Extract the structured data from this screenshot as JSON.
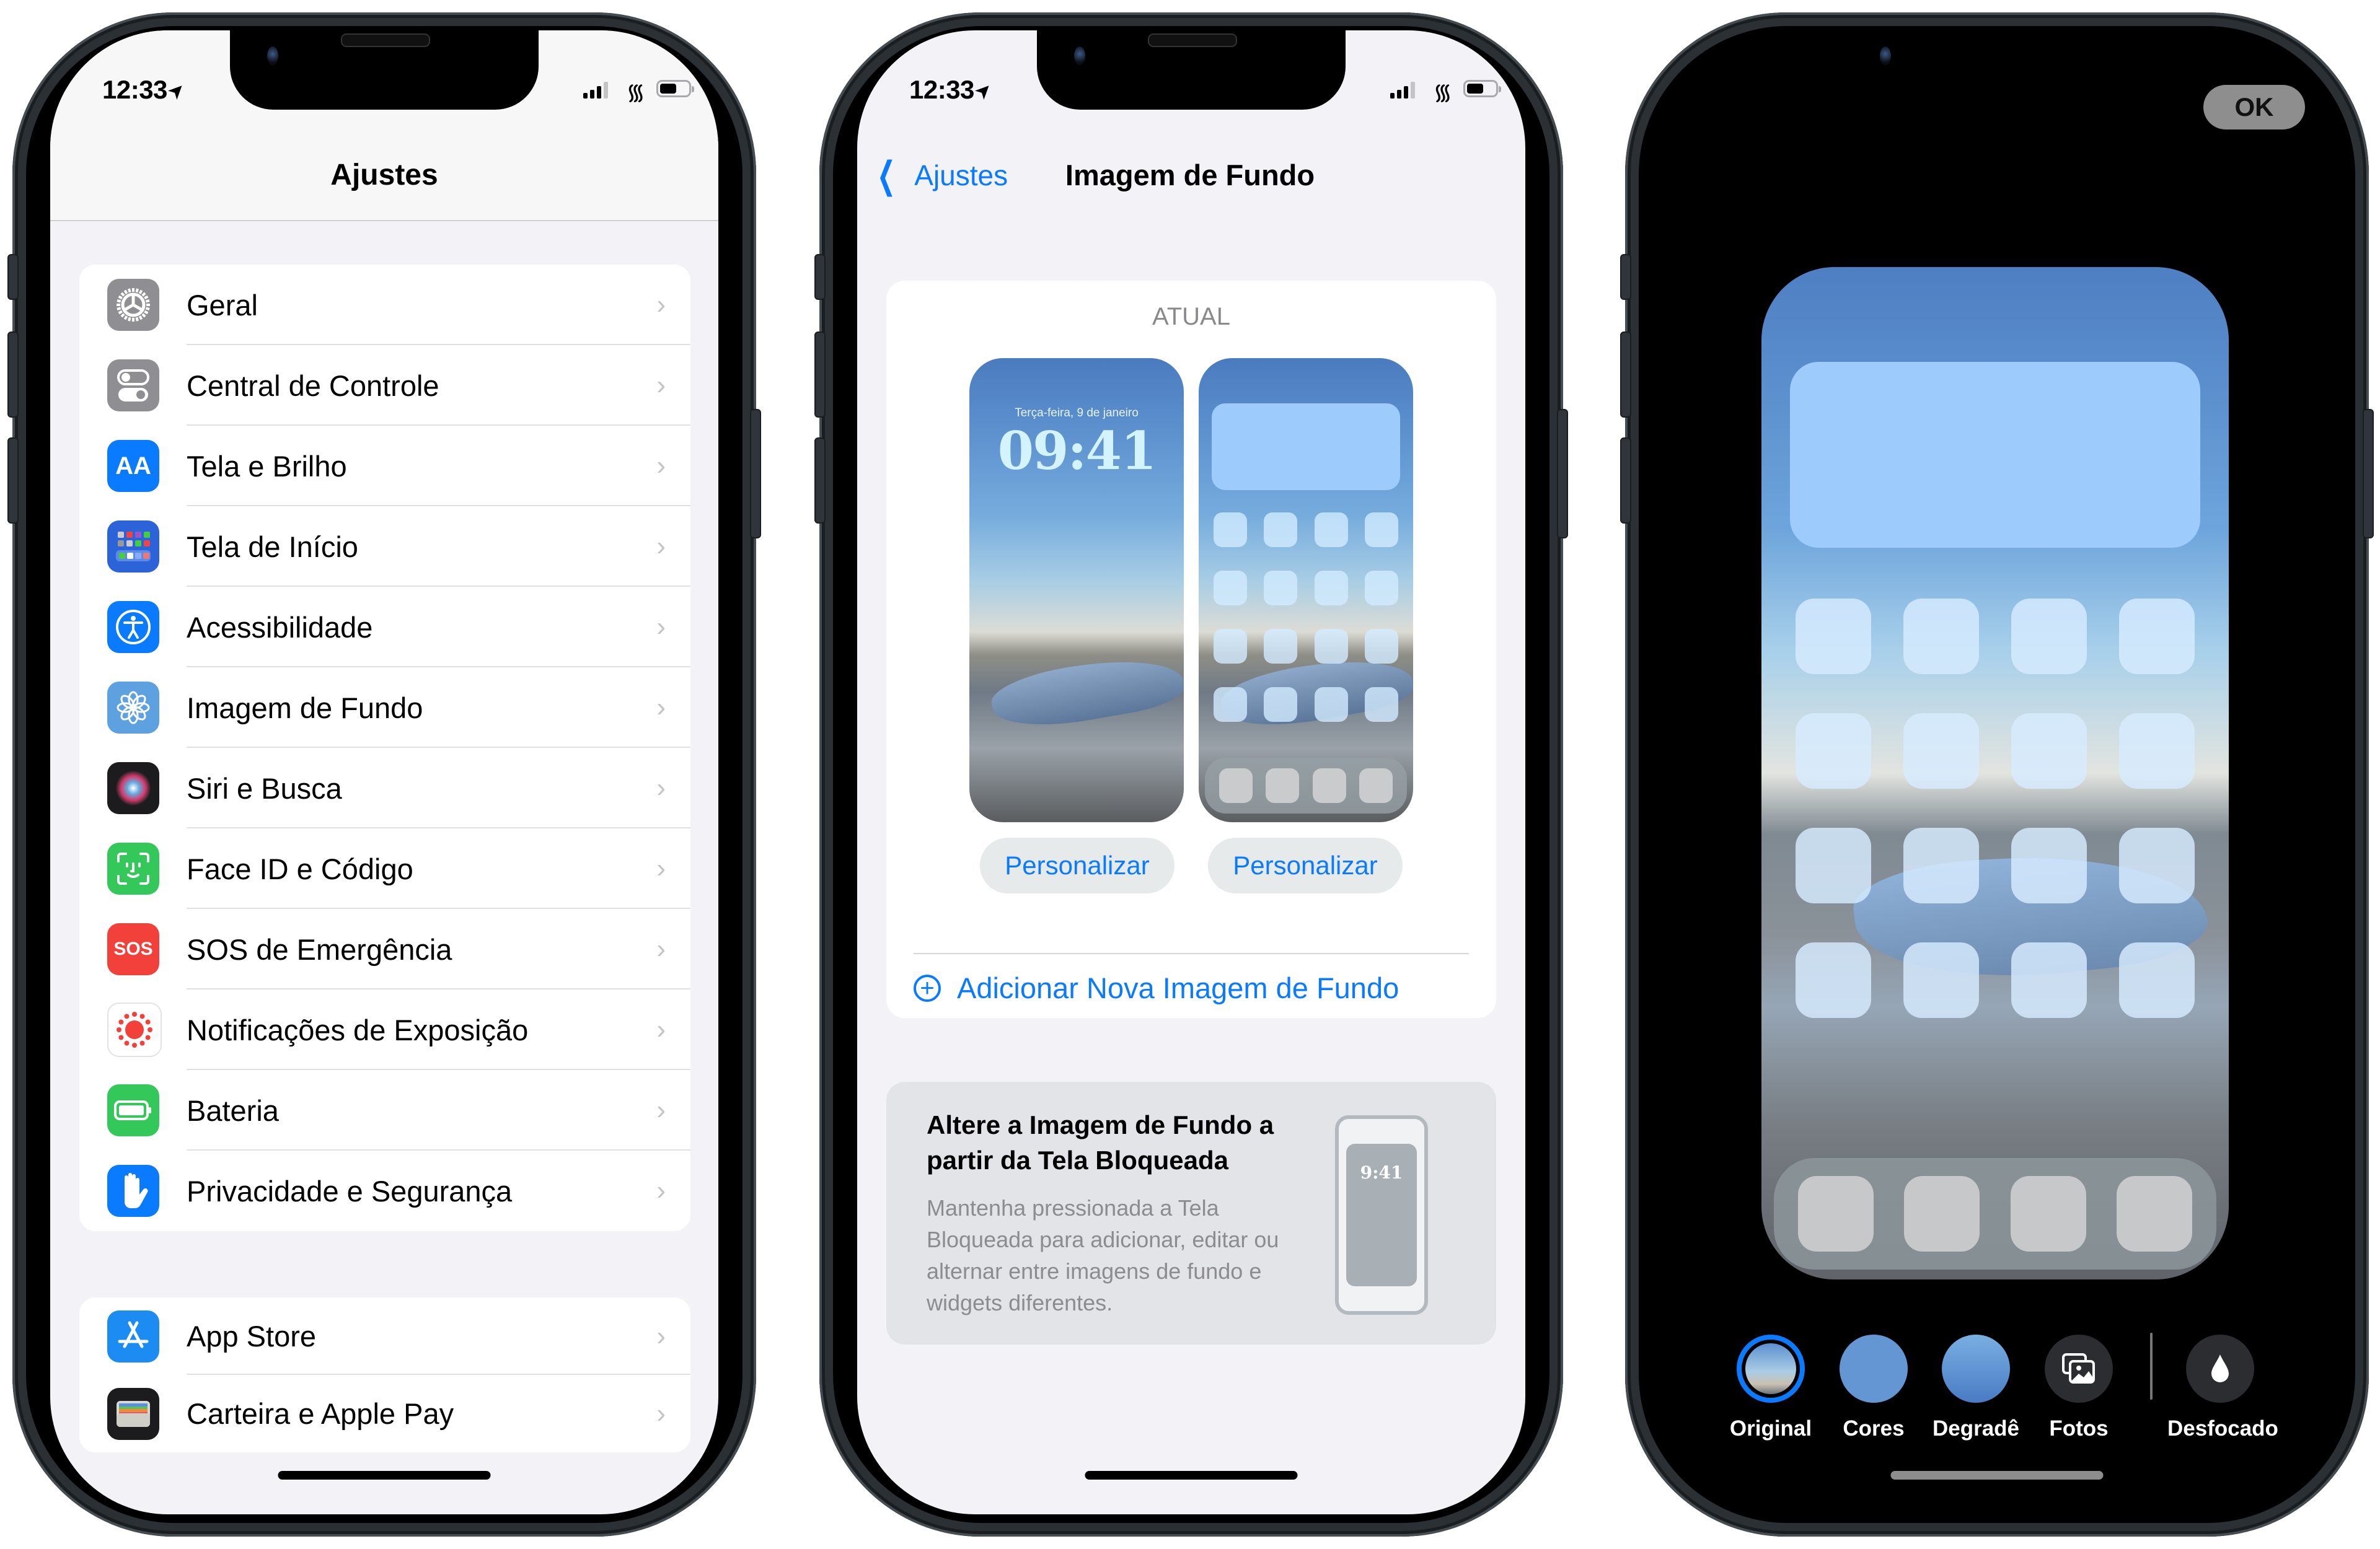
{
  "phones": {
    "settings": {
      "status": {
        "time": "12:33"
      },
      "title": "Ajustes",
      "group1": [
        {
          "label": "Geral",
          "icon": "gear-icon",
          "color": "#8e8e93"
        },
        {
          "label": "Central de Controle",
          "icon": "toggles-icon",
          "color": "#8e8e93"
        },
        {
          "label": "Tela e Brilho",
          "icon": "text-size-icon",
          "color": "#0a7aff"
        },
        {
          "label": "Tela de Início",
          "icon": "home-screen-icon",
          "color": "#2d63d8"
        },
        {
          "label": "Acessibilidade",
          "icon": "accessibility-icon",
          "color": "#0a7aff"
        },
        {
          "label": "Imagem de Fundo",
          "icon": "wallpaper-flower-icon",
          "color": "#5ea1e0"
        },
        {
          "label": "Siri e Busca",
          "icon": "siri-icon",
          "color": "#1c1c1e"
        },
        {
          "label": "Face ID e Código",
          "icon": "face-id-icon",
          "color": "#34c759"
        },
        {
          "label": "SOS de Emergência",
          "icon": "sos-icon",
          "color": "#f2403b"
        },
        {
          "label": "Notificações de Exposição",
          "icon": "exposure-icon",
          "color": "#ffffff"
        },
        {
          "label": "Bateria",
          "icon": "battery-icon",
          "color": "#34c759"
        },
        {
          "label": "Privacidade e Segurança",
          "icon": "hand-icon",
          "color": "#0a7aff"
        }
      ],
      "group2": [
        {
          "label": "App Store",
          "icon": "app-store-icon",
          "color": "#1c8cf2"
        },
        {
          "label": "Carteira e Apple Pay",
          "icon": "wallet-icon",
          "color": "#1c1c1e"
        }
      ],
      "icon_glyphs": {
        "Tela e Brilho": "AA",
        "SOS de Emergência": "SOS"
      }
    },
    "wallpaper": {
      "status": {
        "time": "12:33"
      },
      "back_label": "Ajustes",
      "title": "Imagem de Fundo",
      "current_label": "ATUAL",
      "lock_preview": {
        "date": "Terça-feira, 9 de janeiro",
        "time": "09:41"
      },
      "customize_lock": "Personalizar",
      "customize_home": "Personalizar",
      "add_new": "Adicionar Nova Imagem de Fundo",
      "tip": {
        "title": "Altere a Imagem de Fundo a partir da Tela Bloqueada",
        "body": "Mantenha pressionada a Tela Bloqueada para adicionar, editar ou alternar entre imagens de fundo e widgets diferentes.",
        "illustration_time": "9:41"
      }
    },
    "editor": {
      "ok_label": "OK",
      "options": [
        {
          "label": "Original",
          "selected": true
        },
        {
          "label": "Cores",
          "selected": false
        },
        {
          "label": "Degradê",
          "selected": false
        },
        {
          "label": "Fotos",
          "selected": false
        },
        {
          "label": "Desfocado",
          "selected": false
        }
      ]
    }
  },
  "colors": {
    "accent": "#0a7aff",
    "grouped_background": "#f2f2f7",
    "separator": "#e1e1e4"
  }
}
